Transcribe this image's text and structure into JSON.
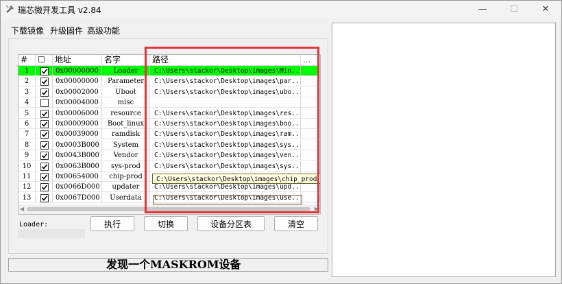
{
  "window": {
    "title": "瑞芯微开发工具 v2.84",
    "controls": {
      "minimize": "—",
      "maximize": "☐",
      "close": "✕"
    }
  },
  "tabs": [
    {
      "label": "下载镜像",
      "active": true
    },
    {
      "label": "升级固件",
      "active": false
    },
    {
      "label": "高级功能",
      "active": false
    }
  ],
  "table": {
    "headers": {
      "idx": "#",
      "check": "☐",
      "address": "地址",
      "name": "名字",
      "path": "路径",
      "extra": "..."
    },
    "rows": [
      {
        "idx": "1",
        "checked": true,
        "address": "0x00000000",
        "name": "Loader",
        "path": "C:\\Users\\stackor\\Desktop\\images\\Min...",
        "selected": true
      },
      {
        "idx": "2",
        "checked": true,
        "address": "0x00000000",
        "name": "Parameter",
        "path": "C:\\Users\\stackor\\Desktop\\images\\par..."
      },
      {
        "idx": "3",
        "checked": true,
        "address": "0x00002000",
        "name": "Uboot",
        "path": "C:\\Users\\stackor\\Desktop\\images\\ubo..."
      },
      {
        "idx": "4",
        "checked": false,
        "address": "0x00004000",
        "name": "misc",
        "path": ""
      },
      {
        "idx": "5",
        "checked": true,
        "address": "0x00006000",
        "name": "resource",
        "path": "C:\\Users\\stackor\\Desktop\\images\\res..."
      },
      {
        "idx": "6",
        "checked": true,
        "address": "0x00009000",
        "name": "Boot_linux",
        "path": "C:\\Users\\stackor\\Desktop\\images\\boo..."
      },
      {
        "idx": "7",
        "checked": true,
        "address": "0x00039000",
        "name": "ramdisk",
        "path": "C:\\Users\\stackor\\Desktop\\images\\ram..."
      },
      {
        "idx": "8",
        "checked": true,
        "address": "0x0003B000",
        "name": "System",
        "path": "C:\\Users\\stackor\\Desktop\\images\\sys..."
      },
      {
        "idx": "9",
        "checked": true,
        "address": "0x0043B000",
        "name": "Vendor",
        "path": "C:\\Users\\stackor\\Desktop\\images\\ven..."
      },
      {
        "idx": "10",
        "checked": true,
        "address": "0x0063B000",
        "name": "sys-prod",
        "path": "C:\\Users\\stackor\\Desktop\\images\\sys..."
      },
      {
        "idx": "11",
        "checked": true,
        "address": "0x00654000",
        "name": "chip-prod",
        "path": "C:\\Users\\stackor\\Desktop\\images\\chip_prod.img"
      },
      {
        "idx": "12",
        "checked": true,
        "address": "0x0066D000",
        "name": "updater",
        "path": "C:\\Users\\stackor\\Desktop\\images\\upd..."
      },
      {
        "idx": "13",
        "checked": true,
        "address": "0x0067D000",
        "name": "Userdata",
        "path": "C:\\Users\\stackor\\Desktop\\images\\use..."
      }
    ],
    "tooltip_path": "C:\\Users\\stackor\\Desktop\\images\\chip_prod.img"
  },
  "loader": {
    "label": "Loader:"
  },
  "buttons": {
    "run": "执行",
    "switch": "切换",
    "partition_table": "设备分区表",
    "clear": "清空"
  },
  "status": {
    "text": "发现一个MASKROM设备"
  },
  "colors": {
    "selected_row": "#00ff00",
    "highlight_box": "#e8333b",
    "tooltip_bg": "#ffffe1"
  }
}
